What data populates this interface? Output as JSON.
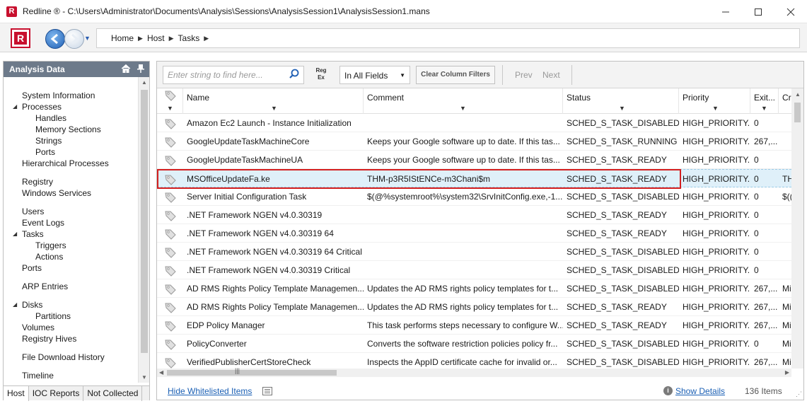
{
  "window": {
    "title": "Redline ® - C:\\Users\\Administrator\\Documents\\Analysis\\Sessions\\AnalysisSession1\\AnalysisSession1.mans"
  },
  "breadcrumb": [
    "Home",
    "Host",
    "Tasks"
  ],
  "left_panel": {
    "title": "Analysis Data",
    "tree": [
      {
        "label": "System Information",
        "level": 1
      },
      {
        "label": "Processes",
        "level": 1,
        "expanded": true
      },
      {
        "label": "Handles",
        "level": 2
      },
      {
        "label": "Memory Sections",
        "level": 2
      },
      {
        "label": "Strings",
        "level": 2
      },
      {
        "label": "Ports",
        "level": 2
      },
      {
        "label": "Hierarchical Processes",
        "level": 1
      },
      {
        "label": "Registry",
        "level": 1,
        "gap": true
      },
      {
        "label": "Windows Services",
        "level": 1
      },
      {
        "label": "Users",
        "level": 1,
        "gap": true
      },
      {
        "label": "Event Logs",
        "level": 1
      },
      {
        "label": "Tasks",
        "level": 1,
        "expanded": true
      },
      {
        "label": "Triggers",
        "level": 2
      },
      {
        "label": "Actions",
        "level": 2
      },
      {
        "label": "Ports",
        "level": 1
      },
      {
        "label": "ARP Entries",
        "level": 1,
        "gap": true
      },
      {
        "label": "Disks",
        "level": 1,
        "expanded": true,
        "gap": true
      },
      {
        "label": "Partitions",
        "level": 2
      },
      {
        "label": "Volumes",
        "level": 1
      },
      {
        "label": "Registry Hives",
        "level": 1
      },
      {
        "label": "File Download History",
        "level": 1,
        "gap": true
      },
      {
        "label": "Timeline",
        "level": 1,
        "gap": true
      }
    ],
    "tabs": [
      "Host",
      "IOC Reports",
      "Not Collected"
    ]
  },
  "toolbar": {
    "search_placeholder": "Enter string to find here...",
    "regex_line1": "Reg",
    "regex_line2": "Ex",
    "field_select": "In All Fields",
    "clear_filters": "Clear Column Filters",
    "prev": "Prev",
    "next": "Next"
  },
  "table": {
    "columns": [
      "Name",
      "Comment",
      "Status",
      "Priority",
      "Exit...",
      "Cr"
    ],
    "rows": [
      {
        "name": "Amazon Ec2 Launch - Instance Initialization",
        "comment": "",
        "status": "SCHED_S_TASK_DISABLED",
        "priority": "HIGH_PRIORITY...",
        "exit": "0",
        "cr": ""
      },
      {
        "name": "GoogleUpdateTaskMachineCore",
        "comment": "Keeps your Google software up to date. If this tas...",
        "status": "SCHED_S_TASK_RUNNING",
        "priority": "HIGH_PRIORITY...",
        "exit": "267,...",
        "cr": ""
      },
      {
        "name": "GoogleUpdateTaskMachineUA",
        "comment": "Keeps your Google software up to date. If this tas...",
        "status": "SCHED_S_TASK_READY",
        "priority": "HIGH_PRIORITY...",
        "exit": "0",
        "cr": ""
      },
      {
        "name": "MSOfficeUpdateFa.ke",
        "comment": "THM-p3R5IStENCe-m3Chani$m",
        "status": "SCHED_S_TASK_READY",
        "priority": "HIGH_PRIORITY...",
        "exit": "0",
        "cr": "TH",
        "highlight": true
      },
      {
        "name": "Server Initial Configuration Task",
        "comment": "$(@%systemroot%\\system32\\SrvInitConfig.exe,-1...",
        "status": "SCHED_S_TASK_DISABLED",
        "priority": "HIGH_PRIORITY...",
        "exit": "0",
        "cr": "$(("
      },
      {
        "name": ".NET Framework NGEN v4.0.30319",
        "comment": "",
        "status": "SCHED_S_TASK_READY",
        "priority": "HIGH_PRIORITY...",
        "exit": "0",
        "cr": ""
      },
      {
        "name": ".NET Framework NGEN v4.0.30319 64",
        "comment": "",
        "status": "SCHED_S_TASK_READY",
        "priority": "HIGH_PRIORITY...",
        "exit": "0",
        "cr": ""
      },
      {
        "name": ".NET Framework NGEN v4.0.30319 64 Critical",
        "comment": "",
        "status": "SCHED_S_TASK_DISABLED",
        "priority": "HIGH_PRIORITY...",
        "exit": "0",
        "cr": ""
      },
      {
        "name": ".NET Framework NGEN v4.0.30319 Critical",
        "comment": "",
        "status": "SCHED_S_TASK_DISABLED",
        "priority": "HIGH_PRIORITY...",
        "exit": "0",
        "cr": ""
      },
      {
        "name": "AD RMS Rights Policy Template Managemen...",
        "comment": "Updates the AD RMS rights policy templates for t...",
        "status": "SCHED_S_TASK_DISABLED",
        "priority": "HIGH_PRIORITY...",
        "exit": "267,...",
        "cr": "Mi"
      },
      {
        "name": "AD RMS Rights Policy Template Managemen...",
        "comment": "Updates the AD RMS rights policy templates for t...",
        "status": "SCHED_S_TASK_READY",
        "priority": "HIGH_PRIORITY...",
        "exit": "267,...",
        "cr": "Mi"
      },
      {
        "name": "EDP Policy Manager",
        "comment": "This task performs steps necessary to configure W...",
        "status": "SCHED_S_TASK_READY",
        "priority": "HIGH_PRIORITY...",
        "exit": "267,...",
        "cr": "Mi"
      },
      {
        "name": "PolicyConverter",
        "comment": "Converts the software restriction policies policy fr...",
        "status": "SCHED_S_TASK_DISABLED",
        "priority": "HIGH_PRIORITY...",
        "exit": "0",
        "cr": "Mi"
      },
      {
        "name": "VerifiedPublisherCertStoreCheck",
        "comment": "Inspects the AppID certificate cache for invalid or...",
        "status": "SCHED_S_TASK_DISABLED",
        "priority": "HIGH_PRIORITY...",
        "exit": "267,...",
        "cr": "Mi"
      }
    ]
  },
  "status_bar": {
    "hide_whitelisted": "Hide Whitelisted Items",
    "show_details": "Show Details",
    "count": "136 Items"
  },
  "colors": {
    "accent_red": "#c8102e",
    "panel_header": "#6d7a8a",
    "link_blue": "#1a5fb4",
    "highlight_row": "#dff0f9"
  }
}
